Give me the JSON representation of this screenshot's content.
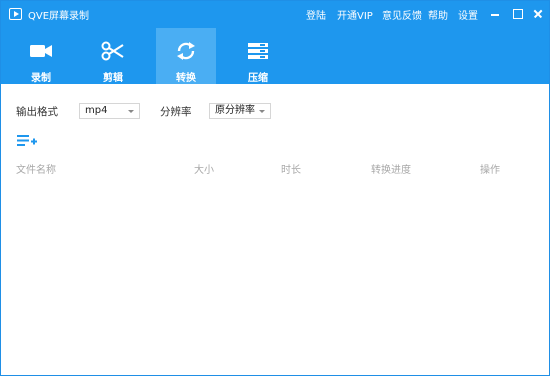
{
  "app": {
    "title": "QVE屏幕录制"
  },
  "menu": [
    "登陆",
    "开通VIP",
    "意见反馈",
    "帮助",
    "设置"
  ],
  "tabs": [
    {
      "label": "录制",
      "icon": "video-camera-icon",
      "active": false
    },
    {
      "label": "剪辑",
      "icon": "scissors-icon",
      "active": false
    },
    {
      "label": "转换",
      "icon": "refresh-icon",
      "active": true
    },
    {
      "label": "压缩",
      "icon": "compress-icon",
      "active": false
    }
  ],
  "convert": {
    "format_label": "输出格式",
    "format_value": "mp4",
    "resolution_label": "分辨率",
    "resolution_value": "原分辨率"
  },
  "table": {
    "columns": [
      "文件名称",
      "大小",
      "时长",
      "转换进度",
      "操作"
    ],
    "rows": []
  },
  "colors": {
    "accent": "#1e97ee",
    "active_tab": "#4aaef3"
  }
}
